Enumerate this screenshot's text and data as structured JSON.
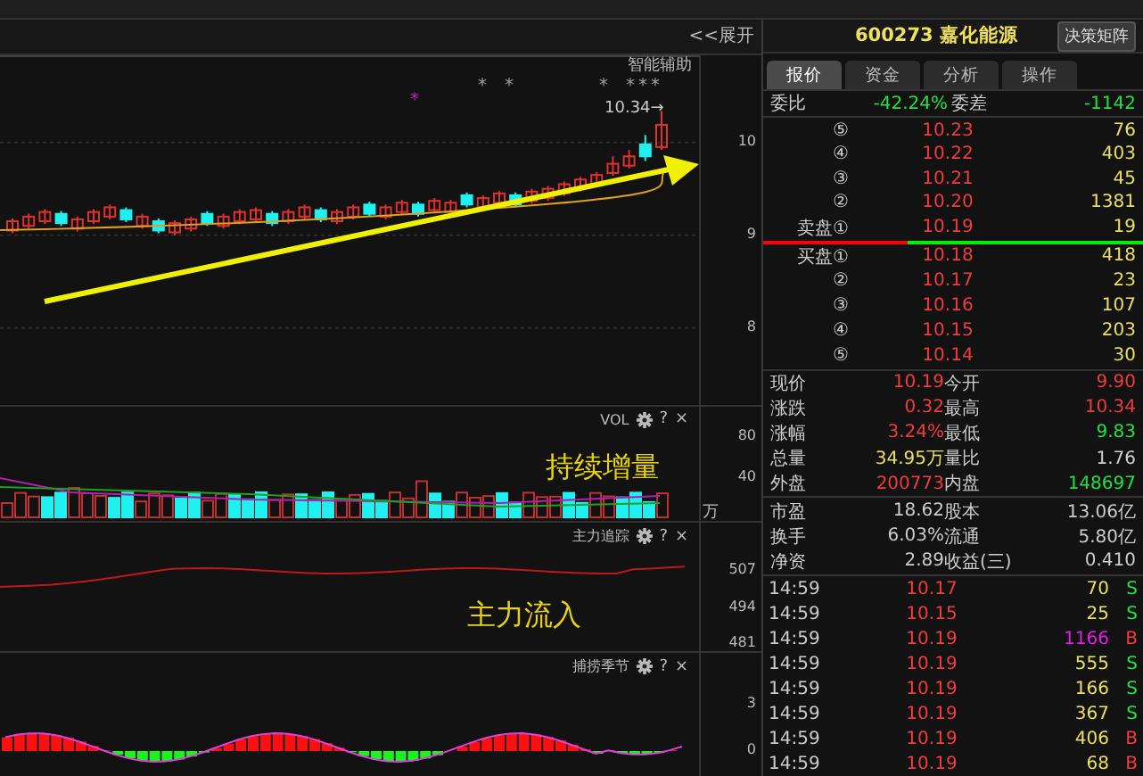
{
  "chart_header": {
    "expand_button": "<<展开"
  },
  "main_chart": {
    "indicator": "智能辅助",
    "high_marker": "10.34→",
    "marks": [
      {
        "text": "*",
        "color": "#a0a0a0"
      },
      {
        "text": "*",
        "color": "#a0a0a0"
      },
      {
        "text": "*",
        "color": "#a0a0a0"
      },
      {
        "text": "*",
        "color": "#a0a0a0"
      },
      {
        "text": "*",
        "color": "#a0a0a0"
      },
      {
        "text": "*",
        "color": "#a0a0a0"
      },
      {
        "text": "*",
        "color": "#c020c0"
      }
    ],
    "chart_data": {
      "type": "candlestick",
      "grid": true,
      "ylim": [
        7.13,
        10.94
      ],
      "yticks": [
        8,
        9,
        10
      ],
      "ohlc": [
        [
          9.05,
          9.18,
          9.02,
          9.15
        ],
        [
          9.1,
          9.23,
          9.07,
          9.2
        ],
        [
          9.15,
          9.28,
          9.12,
          9.25
        ],
        [
          9.23,
          9.26,
          9.1,
          9.13
        ],
        [
          9.07,
          9.2,
          9.04,
          9.17
        ],
        [
          9.15,
          9.28,
          9.12,
          9.25
        ],
        [
          9.2,
          9.33,
          9.17,
          9.3
        ],
        [
          9.27,
          9.3,
          9.14,
          9.17
        ],
        [
          9.1,
          9.23,
          9.07,
          9.2
        ],
        [
          9.15,
          9.18,
          9.02,
          9.05
        ],
        [
          9.03,
          9.16,
          9.0,
          9.13
        ],
        [
          9.07,
          9.2,
          9.04,
          9.17
        ],
        [
          9.23,
          9.26,
          9.1,
          9.13
        ],
        [
          9.1,
          9.23,
          9.07,
          9.2
        ],
        [
          9.15,
          9.28,
          9.12,
          9.25
        ],
        [
          9.17,
          9.3,
          9.14,
          9.27
        ],
        [
          9.23,
          9.26,
          9.1,
          9.13
        ],
        [
          9.15,
          9.28,
          9.12,
          9.25
        ],
        [
          9.2,
          9.33,
          9.17,
          9.3
        ],
        [
          9.27,
          9.3,
          9.14,
          9.17
        ],
        [
          9.15,
          9.28,
          9.12,
          9.25
        ],
        [
          9.2,
          9.33,
          9.17,
          9.3
        ],
        [
          9.33,
          9.36,
          9.2,
          9.23
        ],
        [
          9.2,
          9.33,
          9.17,
          9.3
        ],
        [
          9.25,
          9.38,
          9.22,
          9.35
        ],
        [
          9.33,
          9.36,
          9.2,
          9.23
        ],
        [
          9.27,
          9.4,
          9.24,
          9.37
        ],
        [
          9.25,
          9.38,
          9.22,
          9.35
        ],
        [
          9.43,
          9.46,
          9.3,
          9.33
        ],
        [
          9.3,
          9.43,
          9.27,
          9.4
        ],
        [
          9.35,
          9.48,
          9.32,
          9.45
        ],
        [
          9.43,
          9.46,
          9.3,
          9.33
        ],
        [
          9.37,
          9.5,
          9.34,
          9.47
        ],
        [
          9.4,
          9.53,
          9.37,
          9.5
        ],
        [
          9.45,
          9.58,
          9.42,
          9.55
        ],
        [
          9.5,
          9.63,
          9.47,
          9.6
        ],
        [
          9.55,
          9.68,
          9.52,
          9.65
        ],
        [
          9.67,
          9.85,
          9.64,
          9.77
        ],
        [
          9.75,
          9.92,
          9.72,
          9.85
        ],
        [
          9.98,
          10.08,
          9.8,
          9.85
        ],
        [
          9.95,
          10.34,
          9.92,
          10.19
        ]
      ]
    }
  },
  "volume_panel": {
    "title": "VOL",
    "help": "?",
    "close": "×",
    "overlay_text": "持续增量",
    "y_axis_labels": [
      "80",
      "40"
    ],
    "unit": "万"
  },
  "main_force_panel": {
    "title": "主力追踪",
    "help": "?",
    "close": "×",
    "overlay_text": "主力流入",
    "y_axis_labels": [
      "507",
      "494",
      "481"
    ]
  },
  "season_panel": {
    "title": "捕捞季节",
    "help": "?",
    "close": "×",
    "y_axis_labels": [
      "3",
      "0"
    ]
  },
  "quote_header": {
    "code": "600273",
    "name": "嘉化能源",
    "button": "决策矩阵"
  },
  "tabs": [
    {
      "label": "报价",
      "selected": true
    },
    {
      "label": "资金",
      "selected": false
    },
    {
      "label": "分析",
      "selected": false
    },
    {
      "label": "操作",
      "selected": false
    }
  ],
  "order_ratio": {
    "label": "委比",
    "value": "-42.24%",
    "diff_label": "委差",
    "diff_value": "-1142",
    "color": "#22e040"
  },
  "asks": [
    {
      "label": "⑤",
      "price": "10.23",
      "volume": "76"
    },
    {
      "label": "④",
      "price": "10.22",
      "volume": "403"
    },
    {
      "label": "③",
      "price": "10.21",
      "volume": "45"
    },
    {
      "label": "②",
      "price": "10.20",
      "volume": "1381"
    },
    {
      "label": "卖盘①",
      "price": "10.19",
      "volume": "19"
    }
  ],
  "bids": [
    {
      "label": "买盘①",
      "price": "10.18",
      "volume": "418"
    },
    {
      "label": "②",
      "price": "10.17",
      "volume": "23"
    },
    {
      "label": "③",
      "price": "10.16",
      "volume": "107"
    },
    {
      "label": "④",
      "price": "10.15",
      "volume": "203"
    },
    {
      "label": "⑤",
      "price": "10.14",
      "volume": "30"
    }
  ],
  "stats": [
    [
      {
        "label": "现价",
        "value": "10.19",
        "color": "#f03c3c"
      },
      {
        "label": "今开",
        "value": "9.90",
        "color": "#f03c3c"
      }
    ],
    [
      {
        "label": "涨跌",
        "value": "0.32",
        "color": "#f03c3c"
      },
      {
        "label": "最高",
        "value": "10.34",
        "color": "#f03c3c"
      }
    ],
    [
      {
        "label": "涨幅",
        "value": "3.24%",
        "color": "#f03c3c"
      },
      {
        "label": "最低",
        "value": "9.83",
        "color": "#22e040"
      }
    ],
    [
      {
        "label": "总量",
        "value": "34.95万",
        "color": "#e8e060"
      },
      {
        "label": "量比",
        "value": "1.76",
        "color": "#d0d0d0"
      }
    ],
    [
      {
        "label": "外盘",
        "value": "200773",
        "color": "#f03c3c"
      },
      {
        "label": "内盘",
        "value": "148697",
        "color": "#22e040"
      }
    ]
  ],
  "fundamentals": [
    [
      {
        "label": "市盈",
        "value": "18.62"
      },
      {
        "label": "股本",
        "value": "13.06亿"
      }
    ],
    [
      {
        "label": "换手",
        "value": "6.03%"
      },
      {
        "label": "流通",
        "value": "5.80亿"
      }
    ],
    [
      {
        "label": "净资",
        "value": "2.89"
      },
      {
        "label": "收益(三)",
        "value": "0.410"
      }
    ]
  ],
  "trades": [
    {
      "time": "14:59",
      "price": "10.17",
      "volume": "70",
      "large": false,
      "side": "S",
      "kind": "sell"
    },
    {
      "time": "14:59",
      "price": "10.15",
      "volume": "25",
      "large": false,
      "side": "S",
      "kind": "sell"
    },
    {
      "time": "14:59",
      "price": "10.19",
      "volume": "1166",
      "large": true,
      "side": "B",
      "kind": "buy"
    },
    {
      "time": "14:59",
      "price": "10.19",
      "volume": "555",
      "large": false,
      "side": "S",
      "kind": "sell"
    },
    {
      "time": "14:59",
      "price": "10.19",
      "volume": "166",
      "large": false,
      "side": "S",
      "kind": "sell"
    },
    {
      "time": "14:59",
      "price": "10.19",
      "volume": "367",
      "large": false,
      "side": "S",
      "kind": "sell"
    },
    {
      "time": "14:59",
      "price": "10.19",
      "volume": "406",
      "large": false,
      "side": "B",
      "kind": "buy"
    },
    {
      "time": "14:59",
      "price": "10.19",
      "volume": "68",
      "large": false,
      "side": "B",
      "kind": "buy"
    }
  ]
}
